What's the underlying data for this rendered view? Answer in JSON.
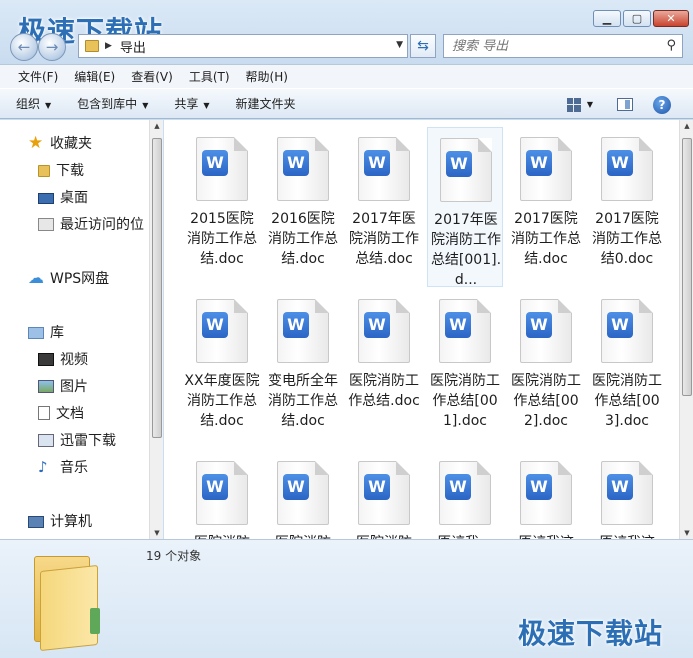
{
  "watermark": "极速下载站",
  "address": {
    "path": "导出"
  },
  "search": {
    "placeholder": "搜索 导出"
  },
  "menu": [
    "文件(F)",
    "编辑(E)",
    "查看(V)",
    "工具(T)",
    "帮助(H)"
  ],
  "commands": {
    "organize": "组织",
    "include": "包含到库中",
    "share": "共享",
    "new_folder": "新建文件夹"
  },
  "nav": {
    "favorites": "收藏夹",
    "downloads": "下载",
    "desktop": "桌面",
    "recent": "最近访问的位",
    "wps": "WPS网盘",
    "library": "库",
    "video": "视频",
    "pictures": "图片",
    "documents": "文档",
    "thunder": "迅雷下载",
    "music": "音乐",
    "computer": "计算机"
  },
  "files": [
    "2015医院消防工作总结.doc",
    "2016医院消防工作总结.doc",
    "2017年医院消防工作总结.doc",
    "2017年医院消防工作总结[001].d...",
    "2017医院消防工作总结.doc",
    "2017医院消防工作总结0.doc",
    "XX年度医院消防工作总结.doc",
    "变电所全年消防工作总结.doc",
    "医院消防工作总结.doc",
    "医院消防工作总结[001].doc",
    "医院消防工作总结[002].doc",
    "医院消防工作总结[003].doc",
    "医院消防",
    "医院消防",
    "医院消防",
    "原谅我一",
    "原谅我这",
    "原谅我这"
  ],
  "status": {
    "count": "19 个对象"
  },
  "icons": {
    "doc_badge": "W"
  }
}
